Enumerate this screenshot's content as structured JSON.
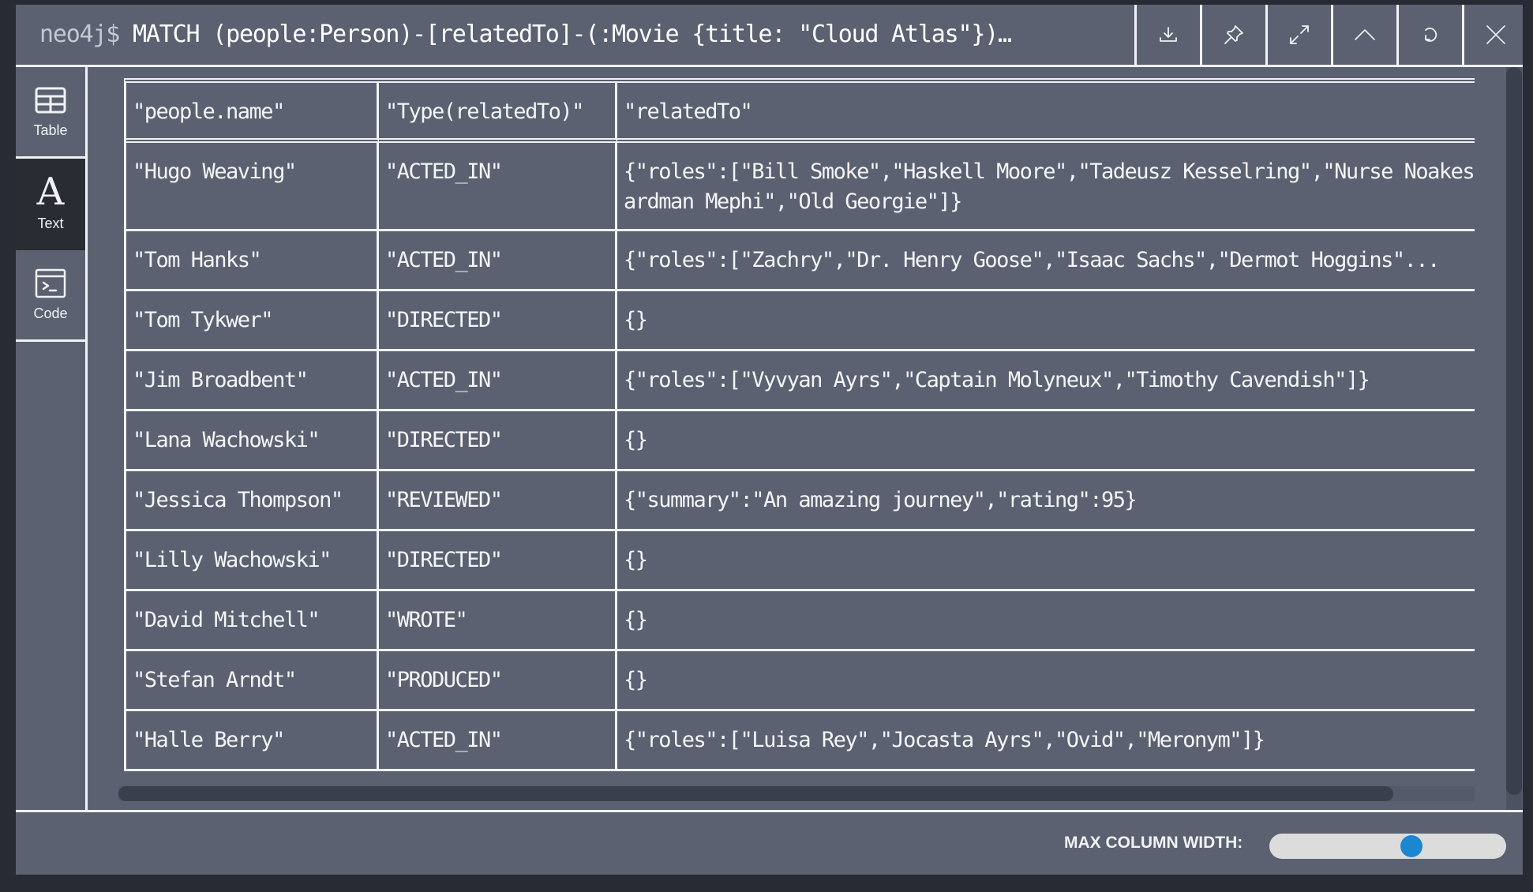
{
  "header": {
    "prompt": "neo4j$",
    "query": "MATCH (people:Person)-[relatedTo]-(:Movie {title: \"Cloud Atlas\"})…",
    "buttons": [
      {
        "name": "download",
        "icon": "download-icon"
      },
      {
        "name": "pin",
        "icon": "pin-icon"
      },
      {
        "name": "fullscreen",
        "icon": "expand-icon"
      },
      {
        "name": "collapse",
        "icon": "chevron-up-icon"
      },
      {
        "name": "rerun",
        "icon": "refresh-icon"
      },
      {
        "name": "close",
        "icon": "close-icon"
      }
    ]
  },
  "sidebar": {
    "items": [
      {
        "label": "Table",
        "icon": "table-icon",
        "active": false
      },
      {
        "label": "Text",
        "icon": "text-icon",
        "active": true
      },
      {
        "label": "Code",
        "icon": "code-icon",
        "active": false
      }
    ]
  },
  "table": {
    "columns": [
      "\"people.name\"",
      "\"Type(relatedTo)\"",
      "\"relatedTo\""
    ],
    "rows": [
      [
        "\"Hugo Weaving\"",
        "\"ACTED_IN\"",
        "{\"roles\":[\"Bill Smoke\",\"Haskell Moore\",\"Tadeusz Kesselring\",\"Nurse Noakes\",\"Boardman Mephi\",\"Old Georgie\"]}"
      ],
      [
        "\"Tom Hanks\"",
        "\"ACTED_IN\"",
        "{\"roles\":[\"Zachry\",\"Dr. Henry Goose\",\"Isaac Sachs\",\"Dermot Hoggins\"..."
      ],
      [
        "\"Tom Tykwer\"",
        "\"DIRECTED\"",
        "{}"
      ],
      [
        "\"Jim Broadbent\"",
        "\"ACTED_IN\"",
        "{\"roles\":[\"Vyvyan Ayrs\",\"Captain Molyneux\",\"Timothy Cavendish\"]}"
      ],
      [
        "\"Lana Wachowski\"",
        "\"DIRECTED\"",
        "{}"
      ],
      [
        "\"Jessica Thompson\"",
        "\"REVIEWED\"",
        "{\"summary\":\"An amazing journey\",\"rating\":95}"
      ],
      [
        "\"Lilly Wachowski\"",
        "\"DIRECTED\"",
        "{}"
      ],
      [
        "\"David Mitchell\"",
        "\"WROTE\"",
        "{}"
      ],
      [
        "\"Stefan Arndt\"",
        "\"PRODUCED\"",
        "{}"
      ],
      [
        "\"Halle Berry\"",
        "\"ACTED_IN\"",
        "{\"roles\":[\"Luisa Rey\",\"Jocasta Ayrs\",\"Ovid\",\"Meronym\"]}"
      ]
    ]
  },
  "scroll": {
    "horizontal_visible_fraction": 0.94,
    "horizontal_position": 0.0,
    "vertical_visible_fraction": 0.98,
    "vertical_position": 0.0
  },
  "footer": {
    "max_column_width_label": "MAX COLUMN WIDTH:",
    "max_column_width_value": 0.6,
    "slider_knob_color": "#1a87d0"
  }
}
